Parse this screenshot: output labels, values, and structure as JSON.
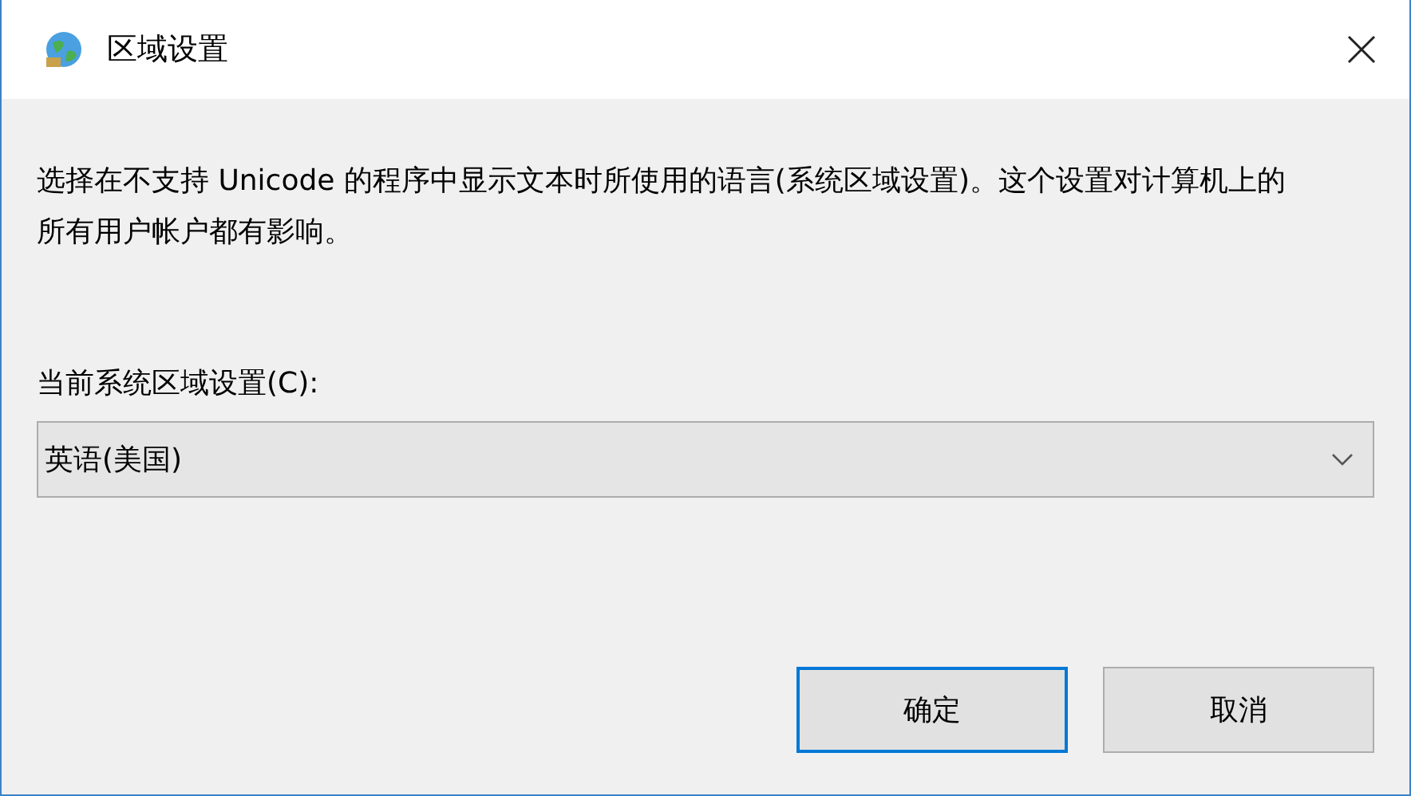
{
  "window": {
    "title": "区域设置"
  },
  "description": "选择在不支持 Unicode 的程序中显示文本时所使用的语言(系统区域设置)。这个设置对计算机上的所有用户帐户都有影响。",
  "locale": {
    "label": "当前系统区域设置(C):",
    "value": "英语(美国)"
  },
  "buttons": [
    {
      "label": "确定",
      "default": true
    },
    {
      "label": "取消",
      "default": false
    }
  ]
}
